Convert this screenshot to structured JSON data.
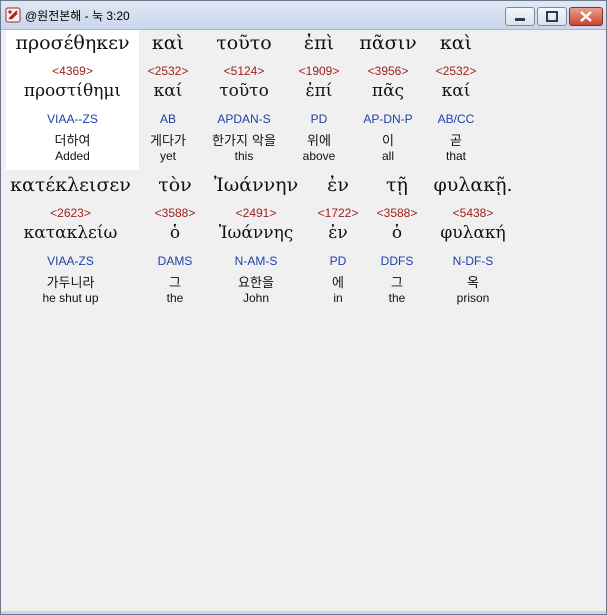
{
  "window": {
    "title": "@원전본해 - 눅 3:20"
  },
  "verse": {
    "line1": [
      {
        "greek": "προσέθηκεν",
        "strong": "<4369>",
        "lemma": "προστίθημι",
        "parse": "VIAA--ZS",
        "korean": "더하여",
        "english": "Added"
      },
      {
        "greek": "καὶ",
        "strong": "<2532>",
        "lemma": "καί",
        "parse": "AB",
        "korean": "게다가",
        "english": "yet"
      },
      {
        "greek": "τοῦτο",
        "strong": "<5124>",
        "lemma": "τοῦτο",
        "parse": "APDAN-S",
        "korean": "한가지 악을",
        "english": "this"
      },
      {
        "greek": "ἐπὶ",
        "strong": "<1909>",
        "lemma": "ἐπί",
        "parse": "PD",
        "korean": "위에",
        "english": "above"
      },
      {
        "greek": "πᾶσιν",
        "strong": "<3956>",
        "lemma": "πᾶς",
        "parse": "AP-DN-P",
        "korean": "이",
        "english": "all"
      },
      {
        "greek": "καὶ",
        "strong": "<2532>",
        "lemma": "καί",
        "parse": "AB/CC",
        "korean": "곧",
        "english": "that"
      }
    ],
    "line2": [
      {
        "greek": "κατέκλεισεν",
        "strong": "<2623>",
        "lemma": "κατακλείω",
        "parse": "VIAA-ZS",
        "korean": "가두니라",
        "english": "he shut up"
      },
      {
        "greek": "τὸν",
        "strong": "<3588>",
        "lemma": "ὁ",
        "parse": "DAMS",
        "korean": "그",
        "english": "the"
      },
      {
        "greek": "Ἰωάννην",
        "strong": "<2491>",
        "lemma": "Ἰωάννης",
        "parse": "N-AM-S",
        "korean": "요한을",
        "english": "John"
      },
      {
        "greek": "ἐν",
        "strong": "<1722>",
        "lemma": "ἐν",
        "parse": "PD",
        "korean": "에",
        "english": "in"
      },
      {
        "greek": "τῇ",
        "strong": "<3588>",
        "lemma": "ὁ",
        "parse": "DDFS",
        "korean": "그",
        "english": "the"
      },
      {
        "greek": "φυλακῇ.",
        "strong": "<5438>",
        "lemma": "φυλακή",
        "parse": "N-DF-S",
        "korean": "옥",
        "english": "prison"
      }
    ]
  },
  "icons": {
    "app": "app-logo-icon",
    "minimize": "minimize-icon",
    "maximize": "maximize-icon",
    "close": "close-icon"
  },
  "colors": {
    "strong_number": "#a01f1f",
    "parsing": "#1f3fa8",
    "selected_background": "#ffffff"
  }
}
